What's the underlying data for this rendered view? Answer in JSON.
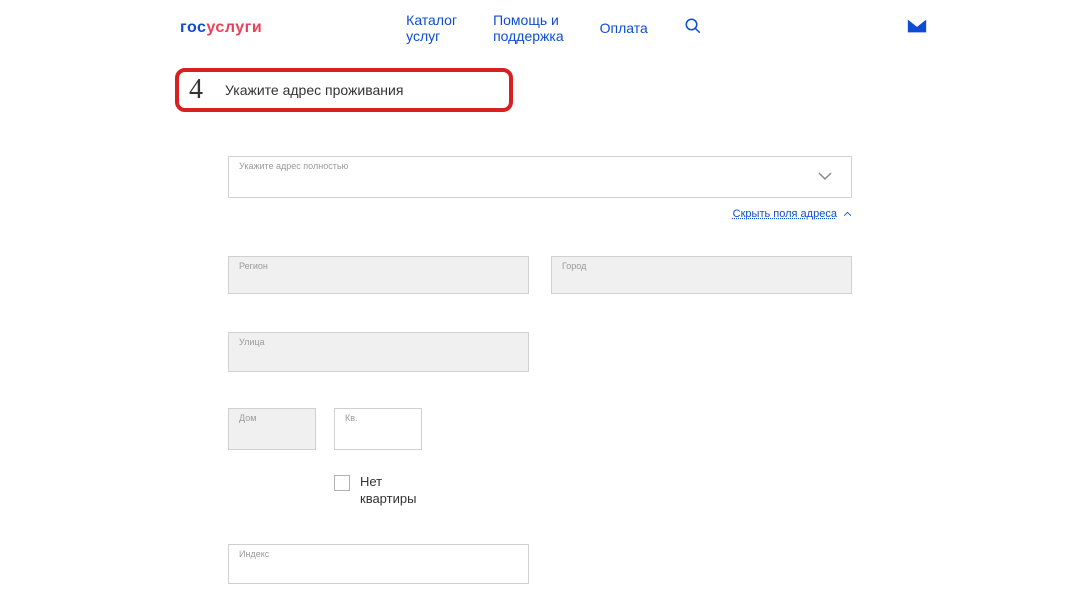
{
  "header": {
    "logo_part1": "гос",
    "logo_part2": "услуги",
    "nav": {
      "catalog": "Каталог услуг",
      "help": "Помощь и поддержка",
      "payment": "Оплата"
    }
  },
  "step": {
    "number": "4",
    "title": "Укажите адрес проживания"
  },
  "form": {
    "full_address_label": "Укажите адрес полностью",
    "hide_fields_link": "Скрыть поля адреса",
    "region_label": "Регион",
    "city_label": "Город",
    "street_label": "Улица",
    "house_label": "Дом",
    "flat_label": "Кв.",
    "no_flat_label": "Нет квартиры",
    "index_label": "Индекс"
  }
}
